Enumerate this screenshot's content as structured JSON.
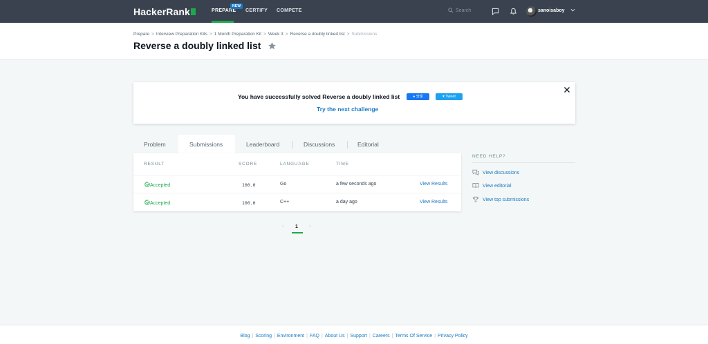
{
  "nav": {
    "logo": "HackerRank",
    "links": [
      "PREPARE",
      "CERTIFY",
      "COMPETE"
    ],
    "new_badge": "NEW",
    "search_placeholder": "Search",
    "username": "sanoisaboy",
    "accent": "#1ba94c",
    "bg": "#39424e"
  },
  "breadcrumb": [
    "Prepare",
    "Interview Preparation Kits",
    "1 Month Preparation Kit",
    "Week 3",
    "Reverse a doubly linked list",
    "Submissions"
  ],
  "page_title": "Reverse a doubly linked list",
  "banner": {
    "message": "You have successfully solved Reverse a doubly linked list",
    "fb_share": "分享",
    "tweet": "Tweet",
    "next_link": "Try the next challenge"
  },
  "tabs": [
    "Problem",
    "Submissions",
    "Leaderboard",
    "Discussions",
    "Editorial"
  ],
  "active_tab": "Submissions",
  "table": {
    "headers": [
      "RESULT",
      "SCORE",
      "LANGUAGE",
      "TIME"
    ],
    "rows": [
      {
        "result": "Accepted",
        "score": "100.0",
        "language": "Go",
        "time": "a few seconds ago",
        "action": "View Results"
      },
      {
        "result": "Accepted",
        "score": "100.0",
        "language": "C++",
        "time": "a day ago",
        "action": "View Results"
      }
    ]
  },
  "pagination": {
    "current": "1"
  },
  "help": {
    "title": "NEED HELP?",
    "items": [
      "View discussions",
      "View editorial",
      "View top submissions"
    ]
  },
  "footer": [
    "Blog",
    "Scoring",
    "Environment",
    "FAQ",
    "About Us",
    "Support",
    "Careers",
    "Terms Of Service",
    "Privacy Policy"
  ]
}
